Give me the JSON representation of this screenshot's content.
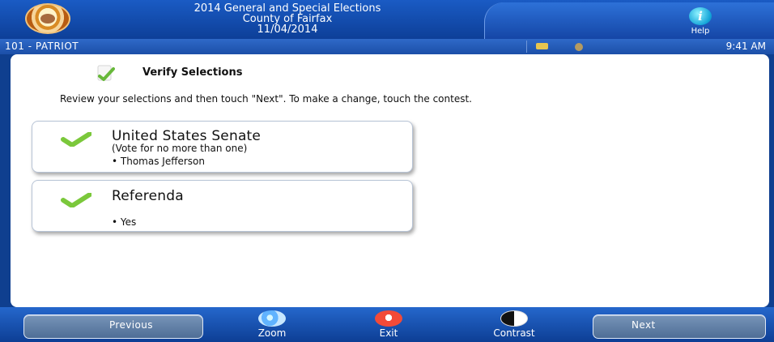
{
  "header": {
    "title_line_1": "2014 General and Special Elections",
    "title_line_2": "County of Fairfax",
    "title_line_3": "11/04/2014",
    "help_label": "Help",
    "help_icon": "info-i-icon"
  },
  "status_bar": {
    "precinct": "101 - PATRIOT",
    "time": "9:41 AM",
    "icons": [
      "folder-icon",
      "power-icon"
    ]
  },
  "main": {
    "title": "Verify Selections",
    "instructions": "Review your selections and then touch \"Next\". To make a change, touch the contest.",
    "contests": [
      {
        "title": "United States Senate",
        "subtitle": "(Vote for no more than one)",
        "selection": "• Thomas Jefferson"
      },
      {
        "title": "Referenda",
        "selection": "• Yes"
      }
    ]
  },
  "footer": {
    "previous_label": "Previous",
    "zoom_label": "Zoom",
    "exit_label": "Exit",
    "contrast_label": "Contrast",
    "next_label": "Next"
  },
  "colors": {
    "primary_blue": "#0f3f8f",
    "header_blue": "#1a5bc4",
    "check_green": "#7bc83b",
    "arrow_green": "#6fdd2e",
    "exit_red": "#f24a38"
  }
}
